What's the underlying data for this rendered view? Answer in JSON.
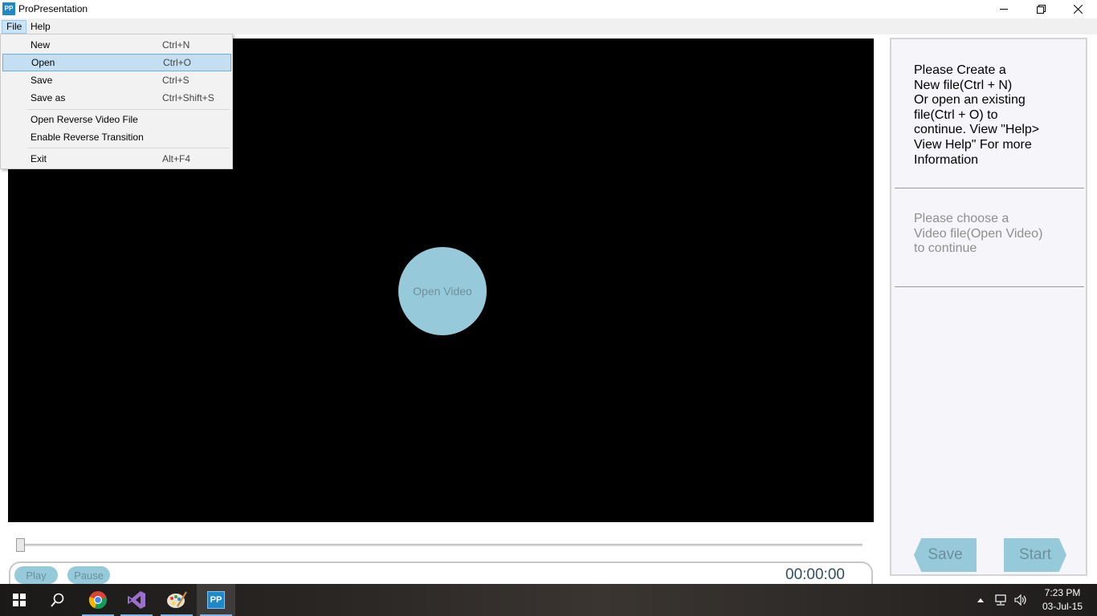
{
  "window": {
    "title": "ProPresentation",
    "app_icon_text": "PP",
    "minimize_glyph": "—",
    "restore_glyph": "❐",
    "close_glyph": "✕"
  },
  "menubar": {
    "file": "File",
    "help": "Help"
  },
  "file_menu": {
    "items": [
      {
        "label": "New",
        "shortcut": "Ctrl+N"
      },
      {
        "label": "Open",
        "shortcut": "Ctrl+O",
        "selected": true
      },
      {
        "label": "Save",
        "shortcut": "Ctrl+S"
      },
      {
        "label": "Save as",
        "shortcut": "Ctrl+Shift+S"
      },
      {
        "label": "Open Reverse Video File",
        "shortcut": ""
      },
      {
        "label": "Enable Reverse Transition",
        "shortcut": ""
      },
      {
        "label": "Exit",
        "shortcut": "Alt+F4"
      }
    ]
  },
  "player": {
    "open_video_label": "Open Video",
    "play_label": "Play",
    "pause_label": "Pause",
    "time": "00:00:00",
    "progress": 0
  },
  "side_panel": {
    "instruction_1": "Please Create a\nNew file(Ctrl + N)\nOr open an existing\nfile(Ctrl + O) to\ncontinue. View \"Help>\nView Help\" For more\nInformation",
    "instruction_2": "Please choose a\nVideo file(Open Video)\nto continue",
    "save_label": "Save",
    "start_label": "Start"
  },
  "taskbar": {
    "time": "7:23 PM",
    "date": "03-Jul-15",
    "pinned": [
      "windows-start-icon",
      "search-icon",
      "chrome-icon",
      "visual-studio-icon",
      "paint-icon",
      "propresentation-icon"
    ],
    "propresentation_icon_text": "PP"
  },
  "colors": {
    "accent": "#96cadb",
    "accent_text": "#6e8f9a",
    "video_background": "#000000",
    "menu_selected": "#c5dff2"
  }
}
